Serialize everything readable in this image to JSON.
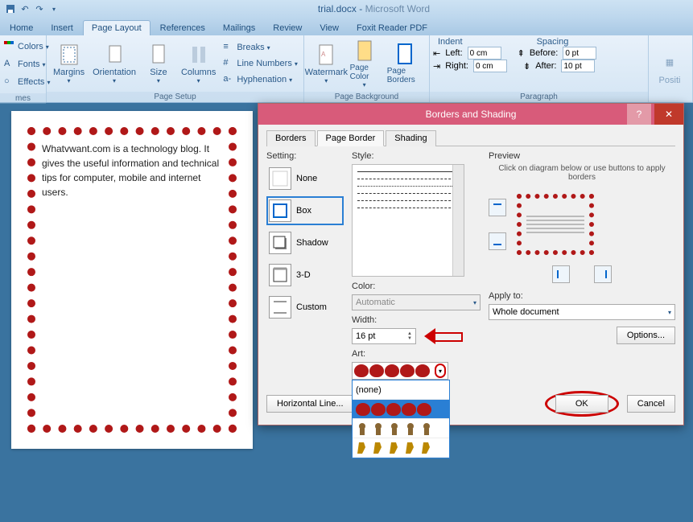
{
  "title": {
    "doc": "trial.docx",
    "app": "Microsoft Word"
  },
  "tabs": [
    "Home",
    "Insert",
    "Page Layout",
    "References",
    "Mailings",
    "Review",
    "View",
    "Foxit Reader PDF"
  ],
  "active_tab": "Page Layout",
  "ribbon": {
    "themes": {
      "label": "mes",
      "colors": "Colors",
      "fonts": "Fonts",
      "effects": "Effects"
    },
    "page_setup": {
      "label": "Page Setup",
      "margins": "Margins",
      "orientation": "Orientation",
      "size": "Size",
      "columns": "Columns",
      "breaks": "Breaks",
      "line_numbers": "Line Numbers",
      "hyphenation": "Hyphenation"
    },
    "page_bg": {
      "label": "Page Background",
      "watermark": "Watermark",
      "page_color": "Page Color",
      "page_borders": "Page Borders"
    },
    "paragraph": {
      "label": "Paragraph",
      "indent": "Indent",
      "spacing": "Spacing",
      "left": "Left:",
      "right": "Right:",
      "before": "Before:",
      "after": "After:",
      "left_v": "0 cm",
      "right_v": "0 cm",
      "before_v": "0 pt",
      "after_v": "10 pt"
    },
    "arrange": {
      "positi": "Positi"
    }
  },
  "page_text": "Whatvwant.com is a technology blog. It gives the useful information and technical tips for computer, mobile and internet users.",
  "dialog": {
    "title": "Borders and Shading",
    "tabs": {
      "borders": "Borders",
      "page_border": "Page Border",
      "shading": "Shading"
    },
    "setting_lbl": "Setting:",
    "settings": {
      "none": "None",
      "box": "Box",
      "shadow": "Shadow",
      "threeD": "3-D",
      "custom": "Custom"
    },
    "style_lbl": "Style:",
    "color_lbl": "Color:",
    "color_v": "Automatic",
    "width_lbl": "Width:",
    "width_v": "16 pt",
    "art_lbl": "Art:",
    "art_none": "(none)",
    "preview_lbl": "Preview",
    "preview_hint": "Click on diagram below or use buttons to apply borders",
    "apply_lbl": "Apply to:",
    "apply_v": "Whole document",
    "options": "Options...",
    "hline": "Horizontal Line...",
    "ok": "OK",
    "cancel": "Cancel"
  }
}
